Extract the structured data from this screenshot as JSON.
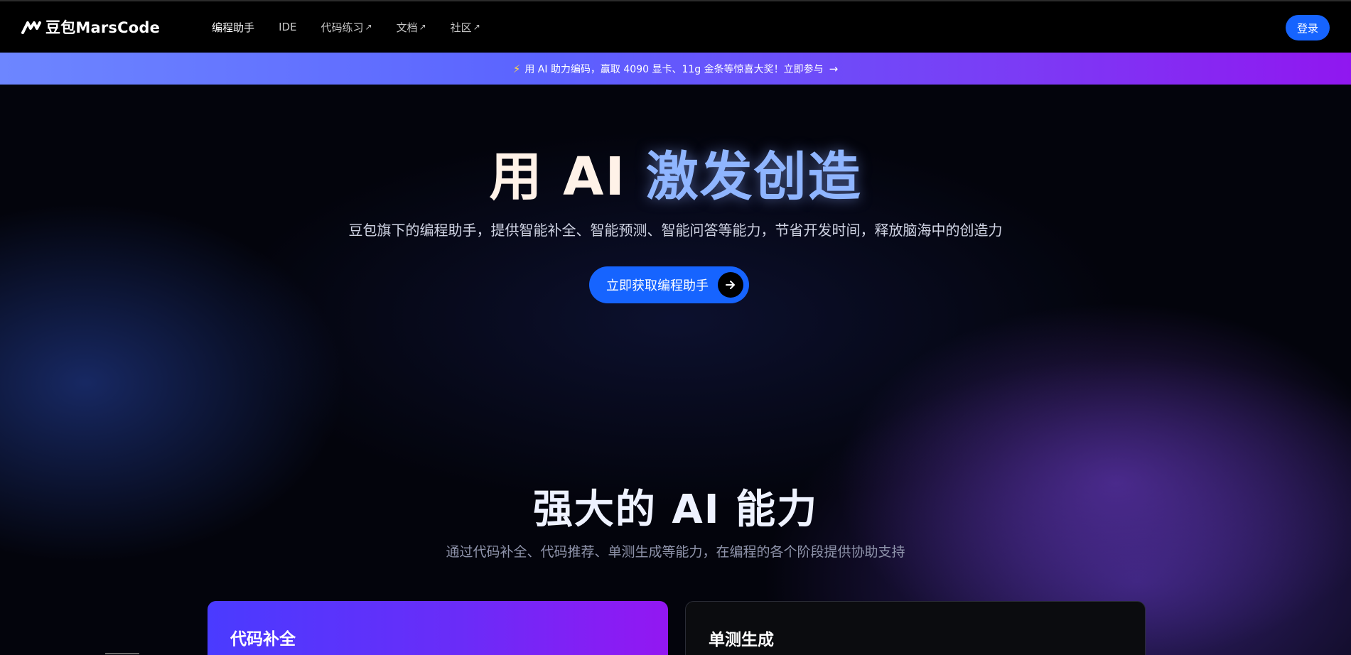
{
  "header": {
    "logo_text": "豆包MarsCode",
    "nav": [
      {
        "label": "编程助手",
        "external": false
      },
      {
        "label": "IDE",
        "external": false
      },
      {
        "label": "代码练习",
        "external": true
      },
      {
        "label": "文档",
        "external": true
      },
      {
        "label": "社区",
        "external": true
      }
    ],
    "external_glyph": "↗",
    "login_label": "登录"
  },
  "banner": {
    "text": "用 AI 助力编码，赢取 4090 显卡、11g 金条等惊喜大奖！立即参与",
    "arrow": "→"
  },
  "hero": {
    "title_part1": "用 AI ",
    "title_part2": "激发创造",
    "subtitle": "豆包旗下的编程助手，提供智能补全、智能预测、智能问答等能力，节省开发时间，释放脑海中的创造力",
    "cta_label": "立即获取编程助手"
  },
  "features": {
    "title": "强大的 AI 能力",
    "subtitle": "通过代码补全、代码推荐、单测生成等能力，在编程的各个阶段提供协助支持",
    "cards": [
      {
        "title": "代码补全"
      },
      {
        "title": "单测生成"
      }
    ]
  },
  "colors": {
    "accent": "#1664ff",
    "banner_start": "#6d86ff",
    "banner_end": "#9017f0",
    "title_highlight": "#8fb5ff"
  }
}
